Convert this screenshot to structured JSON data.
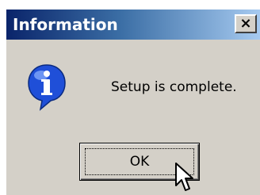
{
  "window": {
    "title": "Information",
    "close_glyph": "×"
  },
  "content": {
    "message": "Setup is complete.",
    "icon": "info-icon"
  },
  "buttons": {
    "ok_label": "OK"
  },
  "colors": {
    "dialog_bg": "#d4d0c8",
    "title_gradient_start": "#0a246a",
    "title_gradient_end": "#a6caf0",
    "info_icon": "#1f4fd8"
  }
}
